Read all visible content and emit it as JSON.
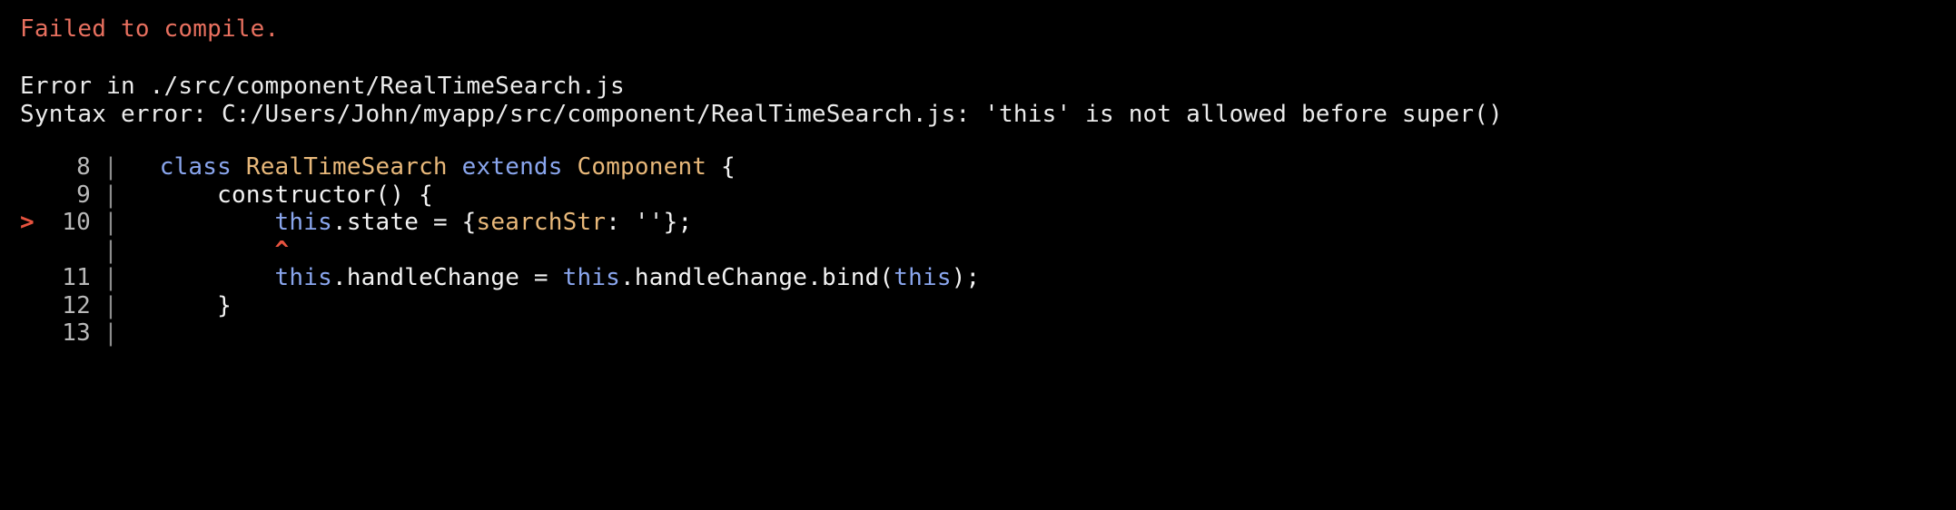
{
  "overlay": {
    "headline": "Failed to compile.",
    "error_location": "Error in ./src/component/RealTimeSearch.js",
    "syntax_error": "Syntax error: C:/Users/John/myapp/src/component/RealTimeSearch.js: 'this' is not allowed before super()"
  },
  "colors": {
    "background": "#000000",
    "headline": "#e8705f",
    "message": "#ebebeb",
    "gutter": "#b9b9b9",
    "pipe": "#8d8d8d",
    "marker": "#e8533f",
    "keyword": "#8aa6ee",
    "classname": "#e8b87a",
    "plain": "#f2f2f2"
  },
  "code_frame": {
    "rows": [
      {
        "marker": "",
        "lineno": "8",
        "pipe": "|",
        "tokens": [
          {
            "t": "  ",
            "c": "tok-plain"
          },
          {
            "t": "class ",
            "c": "tok-kw"
          },
          {
            "t": "RealTimeSearch",
            "c": "tok-cls"
          },
          {
            "t": " extends ",
            "c": "tok-kw"
          },
          {
            "t": "Component",
            "c": "tok-cls"
          },
          {
            "t": " {",
            "c": "tok-punc"
          }
        ]
      },
      {
        "marker": "",
        "lineno": "9",
        "pipe": "|",
        "tokens": [
          {
            "t": "      constructor() {",
            "c": "tok-plain"
          }
        ]
      },
      {
        "marker": ">",
        "lineno": "10",
        "pipe": "|",
        "tokens": [
          {
            "t": "          ",
            "c": "tok-plain"
          },
          {
            "t": "this",
            "c": "tok-this"
          },
          {
            "t": ".state = {",
            "c": "tok-punc"
          },
          {
            "t": "searchStr",
            "c": "tok-prop"
          },
          {
            "t": ": ",
            "c": "tok-punc"
          },
          {
            "t": "''",
            "c": "tok-str"
          },
          {
            "t": "};",
            "c": "tok-punc"
          }
        ]
      },
      {
        "marker": "",
        "lineno": "",
        "pipe": "|",
        "tokens": [
          {
            "t": "          ",
            "c": "tok-plain"
          },
          {
            "t": "^",
            "c": "caret"
          }
        ]
      },
      {
        "marker": "",
        "lineno": "11",
        "pipe": "|",
        "tokens": [
          {
            "t": "          ",
            "c": "tok-plain"
          },
          {
            "t": "this",
            "c": "tok-this"
          },
          {
            "t": ".handleChange = ",
            "c": "tok-punc"
          },
          {
            "t": "this",
            "c": "tok-this"
          },
          {
            "t": ".handleChange.bind(",
            "c": "tok-punc"
          },
          {
            "t": "this",
            "c": "tok-this"
          },
          {
            "t": ");",
            "c": "tok-punc"
          }
        ]
      },
      {
        "marker": "",
        "lineno": "12",
        "pipe": "|",
        "tokens": [
          {
            "t": "      }",
            "c": "tok-plain"
          }
        ]
      },
      {
        "marker": "",
        "lineno": "13",
        "pipe": "|",
        "tokens": [
          {
            "t": "",
            "c": "tok-plain"
          }
        ]
      }
    ]
  }
}
